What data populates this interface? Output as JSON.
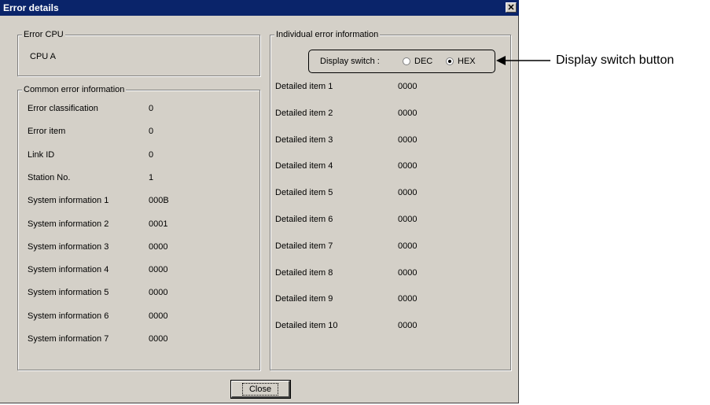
{
  "window": {
    "title": "Error details",
    "close_glyph": "✕"
  },
  "error_cpu": {
    "legend": "Error CPU",
    "value": "CPU A"
  },
  "common": {
    "legend": "Common error information",
    "rows": [
      {
        "label": "Error classification",
        "value": "0"
      },
      {
        "label": "Error item",
        "value": "0"
      },
      {
        "label": "Link ID",
        "value": "0"
      },
      {
        "label": "Station No.",
        "value": "1"
      },
      {
        "label": "System information 1",
        "value": "000B"
      },
      {
        "label": "System information 2",
        "value": "0001"
      },
      {
        "label": "System information 3",
        "value": "0000"
      },
      {
        "label": "System information 4",
        "value": "0000"
      },
      {
        "label": "System information 5",
        "value": "0000"
      },
      {
        "label": "System information 6",
        "value": "0000"
      },
      {
        "label": "System information 7",
        "value": "0000"
      }
    ]
  },
  "individual": {
    "legend": "Individual error information",
    "display_switch": {
      "label": "Display switch :",
      "options": [
        "DEC",
        "HEX"
      ],
      "selected": "HEX"
    },
    "rows": [
      {
        "label": "Detailed item 1",
        "value": "0000"
      },
      {
        "label": "Detailed item 2",
        "value": "0000"
      },
      {
        "label": "Detailed item 3",
        "value": "0000"
      },
      {
        "label": "Detailed item 4",
        "value": "0000"
      },
      {
        "label": "Detailed item 5",
        "value": "0000"
      },
      {
        "label": "Detailed item 6",
        "value": "0000"
      },
      {
        "label": "Detailed item 7",
        "value": "0000"
      },
      {
        "label": "Detailed item 8",
        "value": "0000"
      },
      {
        "label": "Detailed item 9",
        "value": "0000"
      },
      {
        "label": "Detailed item 10",
        "value": "0000"
      }
    ]
  },
  "footer": {
    "close_label": "Close"
  },
  "annotation": {
    "label": "Display switch button"
  }
}
